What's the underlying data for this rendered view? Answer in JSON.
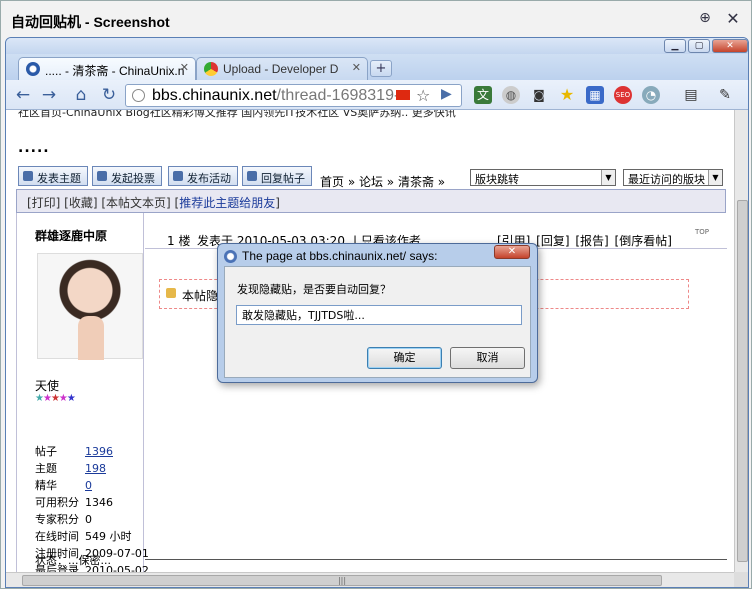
{
  "viewer": {
    "title": "自动回贴机 - Screenshot"
  },
  "tabs": [
    {
      "label": "..... - 清茶斋 - ChinaUnix.n",
      "active": true
    },
    {
      "label": "Upload - Developer D",
      "active": false
    }
  ],
  "address": {
    "host": "bbs.chinaunix.net",
    "path": "/thread-1698319-1-"
  },
  "page": {
    "news": "社区首页-ChinaUnix Blog社区精彩博文推荐 国内领先IT技术社区 VS奥萨苏纳.. 更多快讯",
    "news_more": "更多快讯",
    "title_dots": ".....",
    "actions": [
      "发表主题",
      "发起投票",
      "发布活动",
      "回复帖子"
    ],
    "crumb": "首页 » 论坛 » 清茶斋 »",
    "select_jump": "版块跳转",
    "select_recent": "最近访问的版块",
    "thread_links": "[打印] [收藏] [本帖文本页] [",
    "thread_recommend": "推荐此主题给朋友",
    "thread_close": "]"
  },
  "author": {
    "name": "群雄逐鹿中原",
    "rank": "天使",
    "stars": "★★★★★",
    "stats": [
      {
        "k": "帖子",
        "v": "1396",
        "link": true
      },
      {
        "k": "主题",
        "v": "198",
        "link": true
      },
      {
        "k": "精华",
        "v": "0",
        "link": true
      },
      {
        "k": "可用积分",
        "v": "1346",
        "link": false
      },
      {
        "k": "专家积分",
        "v": "0",
        "link": false
      },
      {
        "k": "在线时间",
        "v": "549 小时",
        "link": false
      },
      {
        "k": "注册时间",
        "v": "2009-07-01",
        "link": false
      },
      {
        "k": "最后登录",
        "v": "2010-05-02",
        "link": false
      }
    ],
    "status": "状态：...保密..."
  },
  "post": {
    "floor": "1 楼",
    "date": "发表于 2010-05-03 03:20",
    "only_author": "| 只看该作者",
    "ops": "[引用] [回复] [报告] [倒序看帖]",
    "top": "TOP",
    "hidden_text": "本帖隐藏"
  },
  "dialog": {
    "title": "The page at bbs.chinaunix.net/ says:",
    "message": "发现隐藏贴，是否要自动回复？",
    "input_value": "敢发隐藏贴，TJJTDS啦...",
    "ok": "确定",
    "cancel": "取消"
  }
}
